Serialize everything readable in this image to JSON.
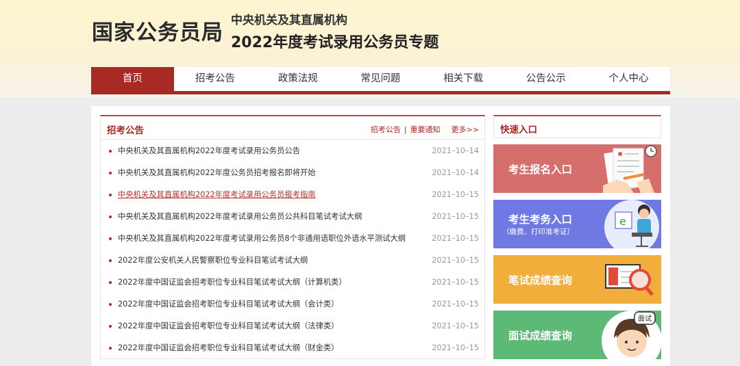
{
  "header": {
    "bureau_name": "国家公务员局",
    "subtitle_line1": "中央机关及其直属机构",
    "subtitle_line2": "2022年度考试录用公务员专题"
  },
  "nav": {
    "items": [
      "首页",
      "招考公告",
      "政策法规",
      "常见问题",
      "相关下载",
      "公告公示",
      "个人中心"
    ],
    "active_index": 0
  },
  "notice_panel": {
    "title": "招考公告",
    "link_announcements": "招考公告",
    "separator": "|",
    "link_important": "重要通知",
    "more": "更多>>",
    "items": [
      {
        "title": "中央机关及其直属机构2022年度考试录用公务员公告",
        "date": "2021–10–14"
      },
      {
        "title": "中央机关及其直属机构2022年度公务员招考报名即将开始",
        "date": "2021–10–14"
      },
      {
        "title": "中央机关及其直属机构2022年度考试录用公务员报考指南",
        "date": "2021–10–15"
      },
      {
        "title": "中央机关及其直属机构2022年度考试录用公务员公共科目笔试考试大纲",
        "date": "2021–10–15"
      },
      {
        "title": "中央机关及其直属机构2022年度考试录用公务员8个非通用语职位外语水平测试大纲",
        "date": "2021–10–15"
      },
      {
        "title": "2022年度公安机关人民警察职位专业科目笔试考试大纲",
        "date": "2021–10–15"
      },
      {
        "title": "2022年度中国证监会招考职位专业科目笔试考试大纲（计算机类）",
        "date": "2021–10–15"
      },
      {
        "title": "2022年度中国证监会招考职位专业科目笔试考试大纲（会计类）",
        "date": "2021–10–15"
      },
      {
        "title": "2022年度中国证监会招考职位专业科目笔试考试大纲（法律类）",
        "date": "2021–10–15"
      },
      {
        "title": "2022年度中国证监会招考职位专业科目笔试考试大纲（财金类）",
        "date": "2021–10–15"
      }
    ]
  },
  "quick_panel": {
    "title": "快速入口",
    "entries": [
      {
        "label": "考生报名入口",
        "icon": "application-form-icon",
        "color": "#d66f6b"
      },
      {
        "label": "考生考务入口",
        "sublabel": "（缴费、打印准考证）",
        "icon": "computer-user-icon",
        "color": "#6f79e3"
      },
      {
        "label": "笔试成绩查询",
        "icon": "monitor-magnifier-icon",
        "color": "#f1ae3a"
      },
      {
        "label": "面试成绩查询",
        "icon": "interview-avatar-icon",
        "icon_text": "面试",
        "color": "#5cb976"
      }
    ]
  },
  "colors": {
    "brand_red": "#a82a25",
    "header_bg": "#fdf5cf"
  }
}
